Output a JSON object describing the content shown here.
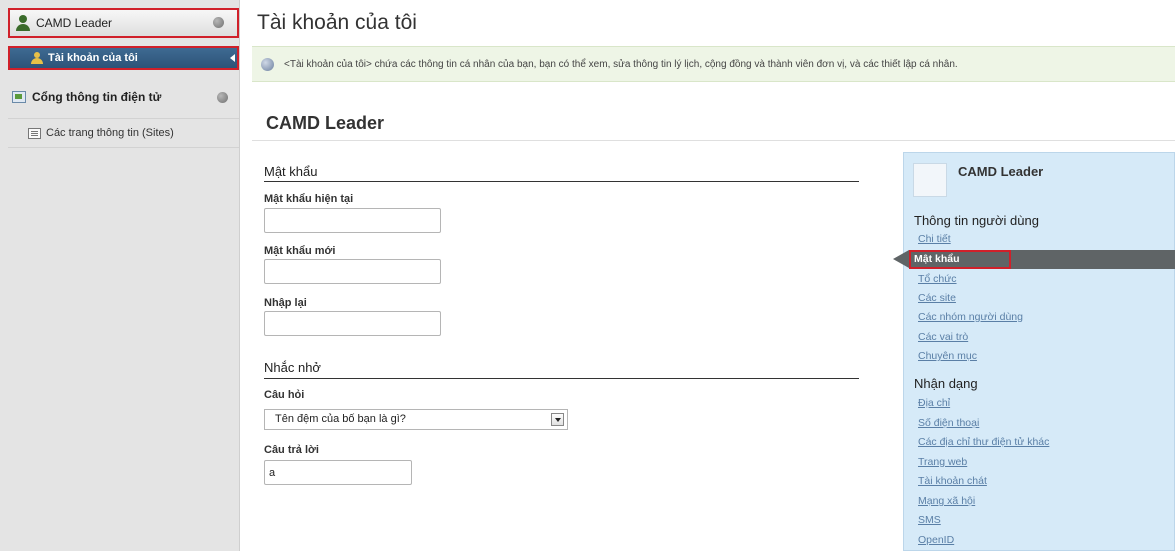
{
  "sidebar": {
    "header_label": "CAMD Leader",
    "active_item_label": "Tài khoản của tôi",
    "group_label": "Cổng thông tin điện tử",
    "sub_item_label": "Các trang thông tin (Sites)"
  },
  "page": {
    "title": "Tài khoản của tôi",
    "info_text": "<Tài khoản của tôi> chứa các thông tin cá nhân của bạn, bạn có thể xem, sửa thông tin lý lịch, cộng đồng và thành viên đơn vị, và các thiết lập cá nhân.",
    "section_title": "CAMD Leader"
  },
  "password_form": {
    "legend": "Mật khẩu",
    "current_label": "Mật khẩu hiện tại",
    "current_value": "",
    "new_label": "Mật khẩu mới",
    "new_value": "",
    "confirm_label": "Nhập lại",
    "confirm_value": ""
  },
  "reminder_form": {
    "legend": "Nhắc nhở",
    "question_label": "Câu hỏi",
    "question_value": "Tên đệm của bố bạn là gì?",
    "answer_label": "Câu trả lời",
    "answer_value": "a"
  },
  "right_panel": {
    "user_name": "CAMD Leader",
    "user_info_heading": "Thông tin người dùng",
    "user_info_links": [
      "Chi tiết",
      "Mật khẩu",
      "Tổ chức",
      "Các site",
      "Các nhóm người dùng",
      "Các vai trò",
      "Chuyên mục"
    ],
    "selected_link": "Mật khẩu",
    "identity_heading": "Nhận dạng",
    "identity_links": [
      "Địa chỉ",
      "Số điện thoại",
      "Các địa chỉ thư điện tử khác",
      "Trang web",
      "Tài khoản chát",
      "Mạng xã hội",
      "SMS",
      "OpenID"
    ]
  },
  "colors": {
    "accent_blue": "#2d5378",
    "highlight_red": "#d0202a",
    "panel_blue": "#d6eaf8",
    "info_green": "#eef5e6"
  }
}
